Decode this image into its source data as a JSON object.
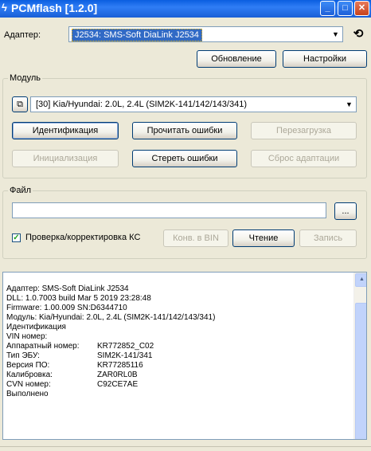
{
  "window": {
    "title": "PCMflash [1.2.0]",
    "app_icon": "lightning-icon",
    "minimize": "_",
    "maximize": "□",
    "close": "✕"
  },
  "adapter": {
    "label": "Адаптер:",
    "value": "J2534: SMS-Soft DiaLink J2534",
    "refresh_icon": "refresh-icon"
  },
  "top_buttons": {
    "update": "Обновление",
    "settings": "Настройки"
  },
  "module": {
    "legend": "Модуль",
    "value": "[30] Kia/Hyundai: 2.0L, 2.4L (SIM2K-141/142/143/341)",
    "buttons": {
      "identify": "Идентификация",
      "read_errors": "Прочитать ошибки",
      "reboot": "Перезагрузка",
      "init": "Инициализация",
      "clear_errors": "Стереть ошибки",
      "reset_adapt": "Сброс адаптации"
    }
  },
  "file": {
    "legend": "Файл",
    "path": "",
    "browse": "...",
    "checksum_label": "Проверка/корректировка КС",
    "checksum_checked": true,
    "buttons": {
      "conv_bin": "Конв. в BIN",
      "read": "Чтение",
      "write": "Запись"
    }
  },
  "log": {
    "lines": [
      "Адаптер: SMS-Soft DiaLink J2534",
      "DLL: 1.0.7003 build Mar  5 2019 23:28:48",
      "Firmware: 1.00.009 SN:D6344710",
      "Модуль: Kia/Hyundai: 2.0L, 2.4L (SIM2K-141/142/143/341)",
      "Идентификация",
      "VIN номер:"
    ],
    "rows": [
      {
        "k": "Аппаратный номер:",
        "v": "KR772852_C02"
      },
      {
        "k": "Тип ЭБУ:",
        "v": "SIM2K-141/341"
      },
      {
        "k": "Версия ПО:",
        "v": "KR77285116"
      },
      {
        "k": "Калибровка:",
        "v": "ZAR0RL0B"
      },
      {
        "k": "CVN номер:",
        "v": "C92CE7AE"
      }
    ],
    "footer": "Выполнено"
  }
}
